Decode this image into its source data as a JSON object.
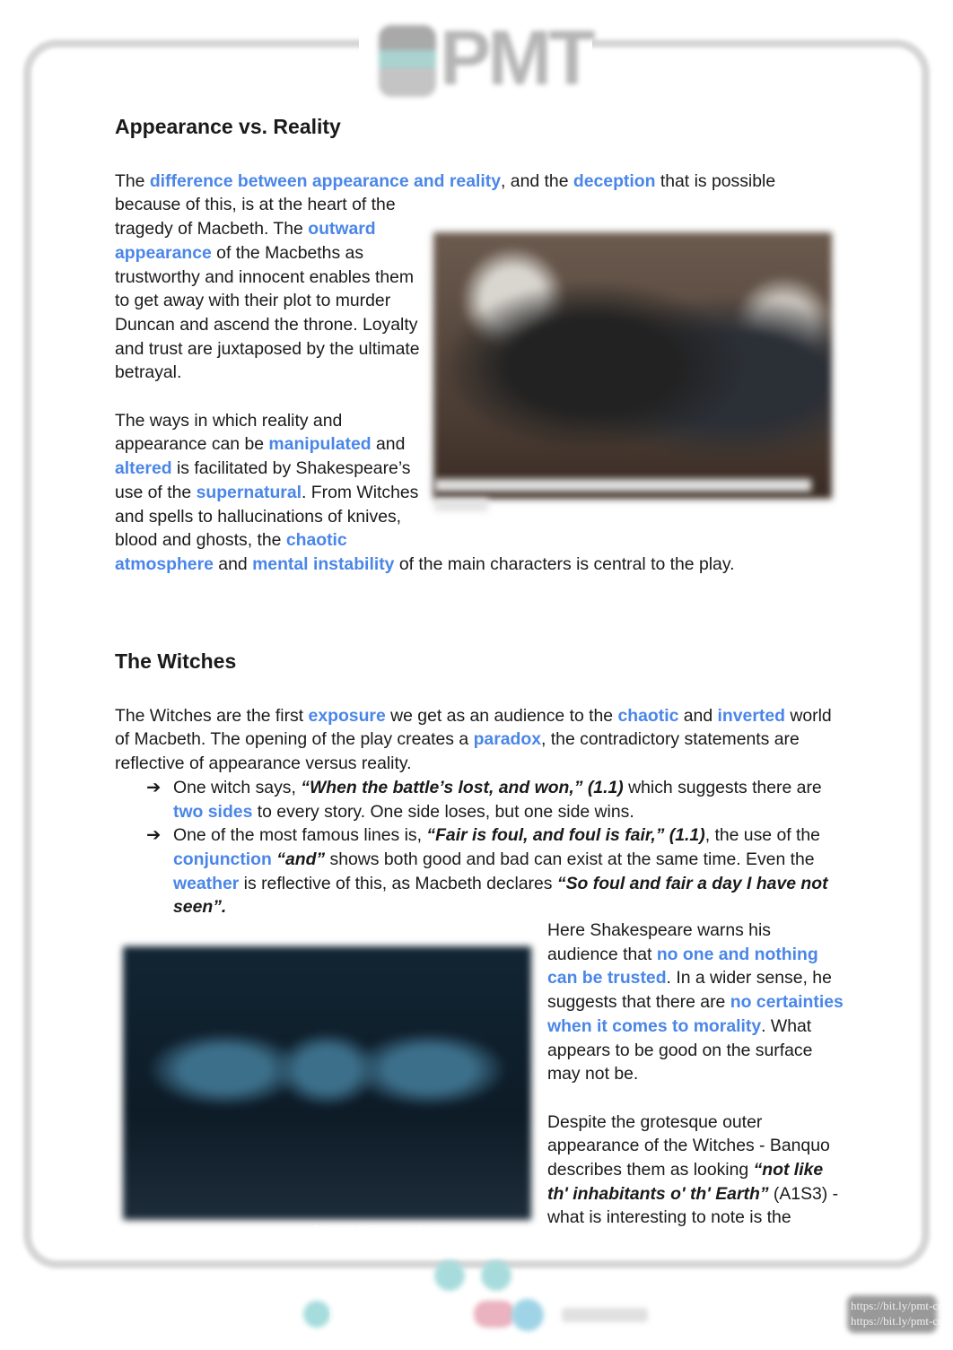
{
  "logo": {
    "text": "PMT"
  },
  "section1": {
    "title": "Appearance vs. Reality",
    "p1": [
      {
        "t": "The ",
        "s": "n"
      },
      {
        "t": "difference between appearance and reality",
        "s": "h"
      },
      {
        "t": ", and the ",
        "s": "n"
      },
      {
        "t": "deception",
        "s": "h"
      },
      {
        "t": " that is possible because of this, is at the heart of the tragedy of Macbeth. The ",
        "s": "n"
      },
      {
        "t": "outward appearance",
        "s": "h"
      },
      {
        "t": " of the Macbeths as trustworthy and innocent enables them to get away with their plot to murder Duncan and ascend the throne. Loyalty and trust are juxtaposed by the ultimate betrayal.",
        "s": "n"
      }
    ],
    "p2": [
      {
        "t": "The ways in which reality and appearance can be ",
        "s": "n"
      },
      {
        "t": "manipulated",
        "s": "h"
      },
      {
        "t": " and ",
        "s": "n"
      },
      {
        "t": "altered",
        "s": "h"
      },
      {
        "t": " is facilitated  by Shakespeare’s use of the ",
        "s": "n"
      },
      {
        "t": "supernatural",
        "s": "h"
      },
      {
        "t": ". From Witches and spells to hallucinations of knives, blood and ghosts, the ",
        "s": "n"
      },
      {
        "t": "chaotic atmosphere",
        "s": "h"
      },
      {
        "t": " and ",
        "s": "n"
      },
      {
        "t": "mental instability",
        "s": "h"
      },
      {
        "t": " of the main characters is central to the play.",
        "s": "n"
      }
    ]
  },
  "section2": {
    "title": "The Witches",
    "p1": [
      {
        "t": "The Witches are the first ",
        "s": "n"
      },
      {
        "t": "exposure",
        "s": "h"
      },
      {
        "t": " we get as an audience to the ",
        "s": "n"
      },
      {
        "t": "chaotic",
        "s": "h"
      },
      {
        "t": " and ",
        "s": "n"
      },
      {
        "t": "inverted",
        "s": "h"
      },
      {
        "t": " world of Macbeth. The opening of the play creates a ",
        "s": "n"
      },
      {
        "t": "paradox",
        "s": "h"
      },
      {
        "t": ", the contradictory statements are reflective of appearance versus reality.",
        "s": "n"
      }
    ],
    "bullet_icon": "arrow-right-icon",
    "bullet_glyph": "➔",
    "bullets": [
      [
        {
          "t": "One witch says, ",
          "s": "n"
        },
        {
          "t": "“When the battle’s lost, and won,” (1.1)",
          "s": "bi"
        },
        {
          "t": " which suggests there are ",
          "s": "n"
        },
        {
          "t": "two sides",
          "s": "h"
        },
        {
          "t": " to every story. One side loses, but one side wins.",
          "s": "n"
        }
      ],
      [
        {
          "t": "One of the most famous lines is, ",
          "s": "n"
        },
        {
          "t": "“Fair is foul, and foul is fair,” (1.1)",
          "s": "bi"
        },
        {
          "t": ", the use of the ",
          "s": "n"
        },
        {
          "t": "conjunction",
          "s": "h"
        },
        {
          "t": "  ",
          "s": "n"
        },
        {
          "t": "“and”",
          "s": "bi"
        },
        {
          "t": " shows both good and bad can exist at the same time. Even the ",
          "s": "n"
        },
        {
          "t": "weather",
          "s": "h"
        },
        {
          "t": " is reflective of this, as Macbeth declares ",
          "s": "n"
        },
        {
          "t": "“So foul and fair a day I have not seen”.",
          "s": "bi"
        }
      ]
    ],
    "p2": [
      {
        "t": "Here Shakespeare warns his audience that ",
        "s": "n"
      },
      {
        "t": "no one and nothing can be trusted",
        "s": "h"
      },
      {
        "t": ". In a wider sense, he suggests that there are ",
        "s": "n"
      },
      {
        "t": "no certainties when it comes to morality",
        "s": "h"
      },
      {
        "t": ". What appears to be good on the surface may not be.",
        "s": "n"
      }
    ],
    "p3": [
      {
        "t": "Despite the grotesque outer appearance of the Witches - Banquo describes them as looking ",
        "s": "n"
      },
      {
        "t": "“not like th' inhabitants o' th' Earth”",
        "s": "bi"
      },
      {
        "t": " (A1S3) - what is interesting to note is the",
        "s": "n"
      }
    ]
  },
  "watermarks": {
    "image": "https://bit.ly/pmt-edu-cc",
    "footer_link": "https://bit.ly/pmt-edu",
    "corner1": "https://bit.ly/pmt-cc",
    "corner2": "https://bit.ly/pmt-cc"
  },
  "colors": {
    "highlight": "#4a86e8",
    "frame": "#d6d6d6"
  }
}
